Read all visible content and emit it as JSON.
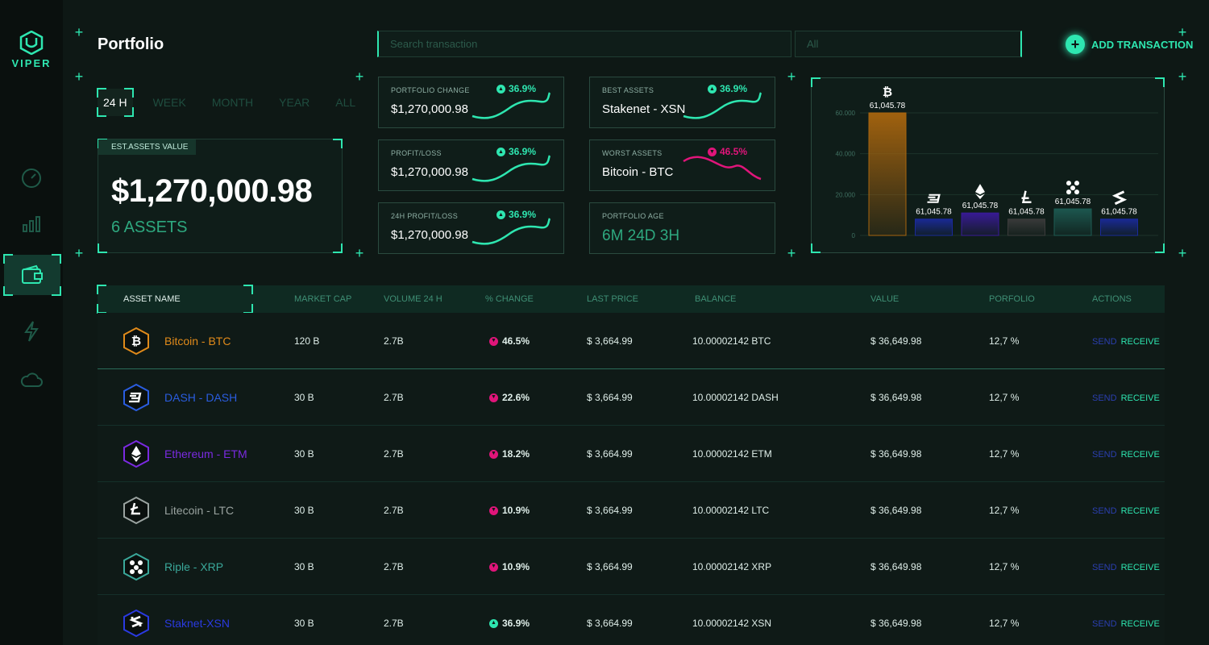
{
  "app": {
    "logo_text": "VIPER",
    "page_title": "Portfolio"
  },
  "colors": {
    "accent": "#2ee6b0",
    "down": "#e0157a",
    "bg": "#0e1815"
  },
  "sidebar": {
    "items": [
      {
        "icon": "speedometer-icon"
      },
      {
        "icon": "bar-chart-icon"
      },
      {
        "icon": "wallet-icon",
        "active": true
      },
      {
        "icon": "lightning-icon"
      },
      {
        "icon": "cloud-icon"
      }
    ]
  },
  "header": {
    "search_placeholder": "Search transaction",
    "filter_value": "All",
    "add_transaction_label": "ADD TRANSACTION"
  },
  "periods": [
    "24 H",
    "WEEK",
    "MONTH",
    "YEAR",
    "ALL"
  ],
  "estimate": {
    "label": "EST.ASSETS VALUE",
    "value": "$1,270,000.98",
    "assets": "6 ASSETS"
  },
  "cards": {
    "portfolio_change": {
      "label": "PORTFOLIO CHANGE",
      "value": "$1,270,000.98",
      "change": "36.9%"
    },
    "profit_loss": {
      "label": "PROFIT/LOSS",
      "value": "$1,270,000.98",
      "change": "36.9%"
    },
    "profit_24h": {
      "label": "24H PROFIT/LOSS",
      "value": "$1,270,000.98",
      "change": "36.9%"
    },
    "best_assets": {
      "label": "BEST ASSETS",
      "value": "Stakenet - XSN",
      "change": "36.9%"
    },
    "worst_assets": {
      "label": "WORST ASSETS",
      "value": "Bitcoin - BTC",
      "change": "46.5%"
    },
    "portfolio_age": {
      "label": "PORTFOLIO AGE",
      "value": "6M 24D 3H"
    }
  },
  "chart_data": {
    "type": "bar",
    "categories": [
      "BTC",
      "DASH",
      "ETH",
      "LTC",
      "XRP",
      "XSN"
    ],
    "values": [
      60000,
      8000,
      11000,
      8000,
      13000,
      8000
    ],
    "data_labels": [
      "61,045.78",
      "61,045.78",
      "61,045.78",
      "61,045.78",
      "61,045.78",
      "61,045.78"
    ],
    "yticks": [
      "0",
      "20.000",
      "40.000",
      "60.000"
    ],
    "ylim": [
      0,
      60000
    ],
    "bar_colors": [
      "#a8650e",
      "#1a2a9a",
      "#3a1a9a",
      "#3b3b3b",
      "#1d5a52",
      "#1a2a9a"
    ],
    "grid": true
  },
  "table": {
    "headers": [
      "ASSET NAME",
      "MARKET CAP",
      "VOLUME 24 H",
      "% CHANGE",
      "LAST PRICE",
      "BALANCE",
      "VALUE",
      "PORFOLIO",
      "ACTIONS"
    ],
    "send_label": "SEND",
    "receive_label": "RECEIVE",
    "rows": [
      {
        "name": "Bitcoin - BTC",
        "color": "#e08a1a",
        "market_cap": "120 B",
        "volume": "2.7B",
        "change": "46.5%",
        "dir": "down",
        "price": "$ 3,664.99",
        "balance": "10.00002142 BTC",
        "value": "$ 36,649.98",
        "portfolio": "12,7 %"
      },
      {
        "name": "DASH - DASH",
        "color": "#2a5de0",
        "market_cap": "30 B",
        "volume": "2.7B",
        "change": "22.6%",
        "dir": "down",
        "price": "$ 3,664.99",
        "balance": "10.00002142 DASH",
        "value": "$ 36,649.98",
        "portfolio": "12,7 %"
      },
      {
        "name": "Ethereum - ETM",
        "color": "#7a2ae0",
        "market_cap": "30 B",
        "volume": "2.7B",
        "change": "18.2%",
        "dir": "down",
        "price": "$ 3,664.99",
        "balance": "10.00002142 ETM",
        "value": "$ 36,649.98",
        "portfolio": "12,7 %"
      },
      {
        "name": "Litecoin - LTC",
        "color": "#9aa3a0",
        "market_cap": "30 B",
        "volume": "2.7B",
        "change": "10.9%",
        "dir": "down",
        "price": "$ 3,664.99",
        "balance": "10.00002142 LTC",
        "value": "$ 36,649.98",
        "portfolio": "12,7 %"
      },
      {
        "name": "Riple - XRP",
        "color": "#3aa89a",
        "market_cap": "30 B",
        "volume": "2.7B",
        "change": "10.9%",
        "dir": "down",
        "price": "$ 3,664.99",
        "balance": "10.00002142 XRP",
        "value": "$ 36,649.98",
        "portfolio": "12,7 %"
      },
      {
        "name": "Staknet-XSN",
        "color": "#2a3ae0",
        "market_cap": "30 B",
        "volume": "2.7B",
        "change": "36.9%",
        "dir": "up",
        "price": "$ 3,664.99",
        "balance": "10.00002142 XSN",
        "value": "$ 36,649.98",
        "portfolio": "12,7 %"
      }
    ]
  }
}
